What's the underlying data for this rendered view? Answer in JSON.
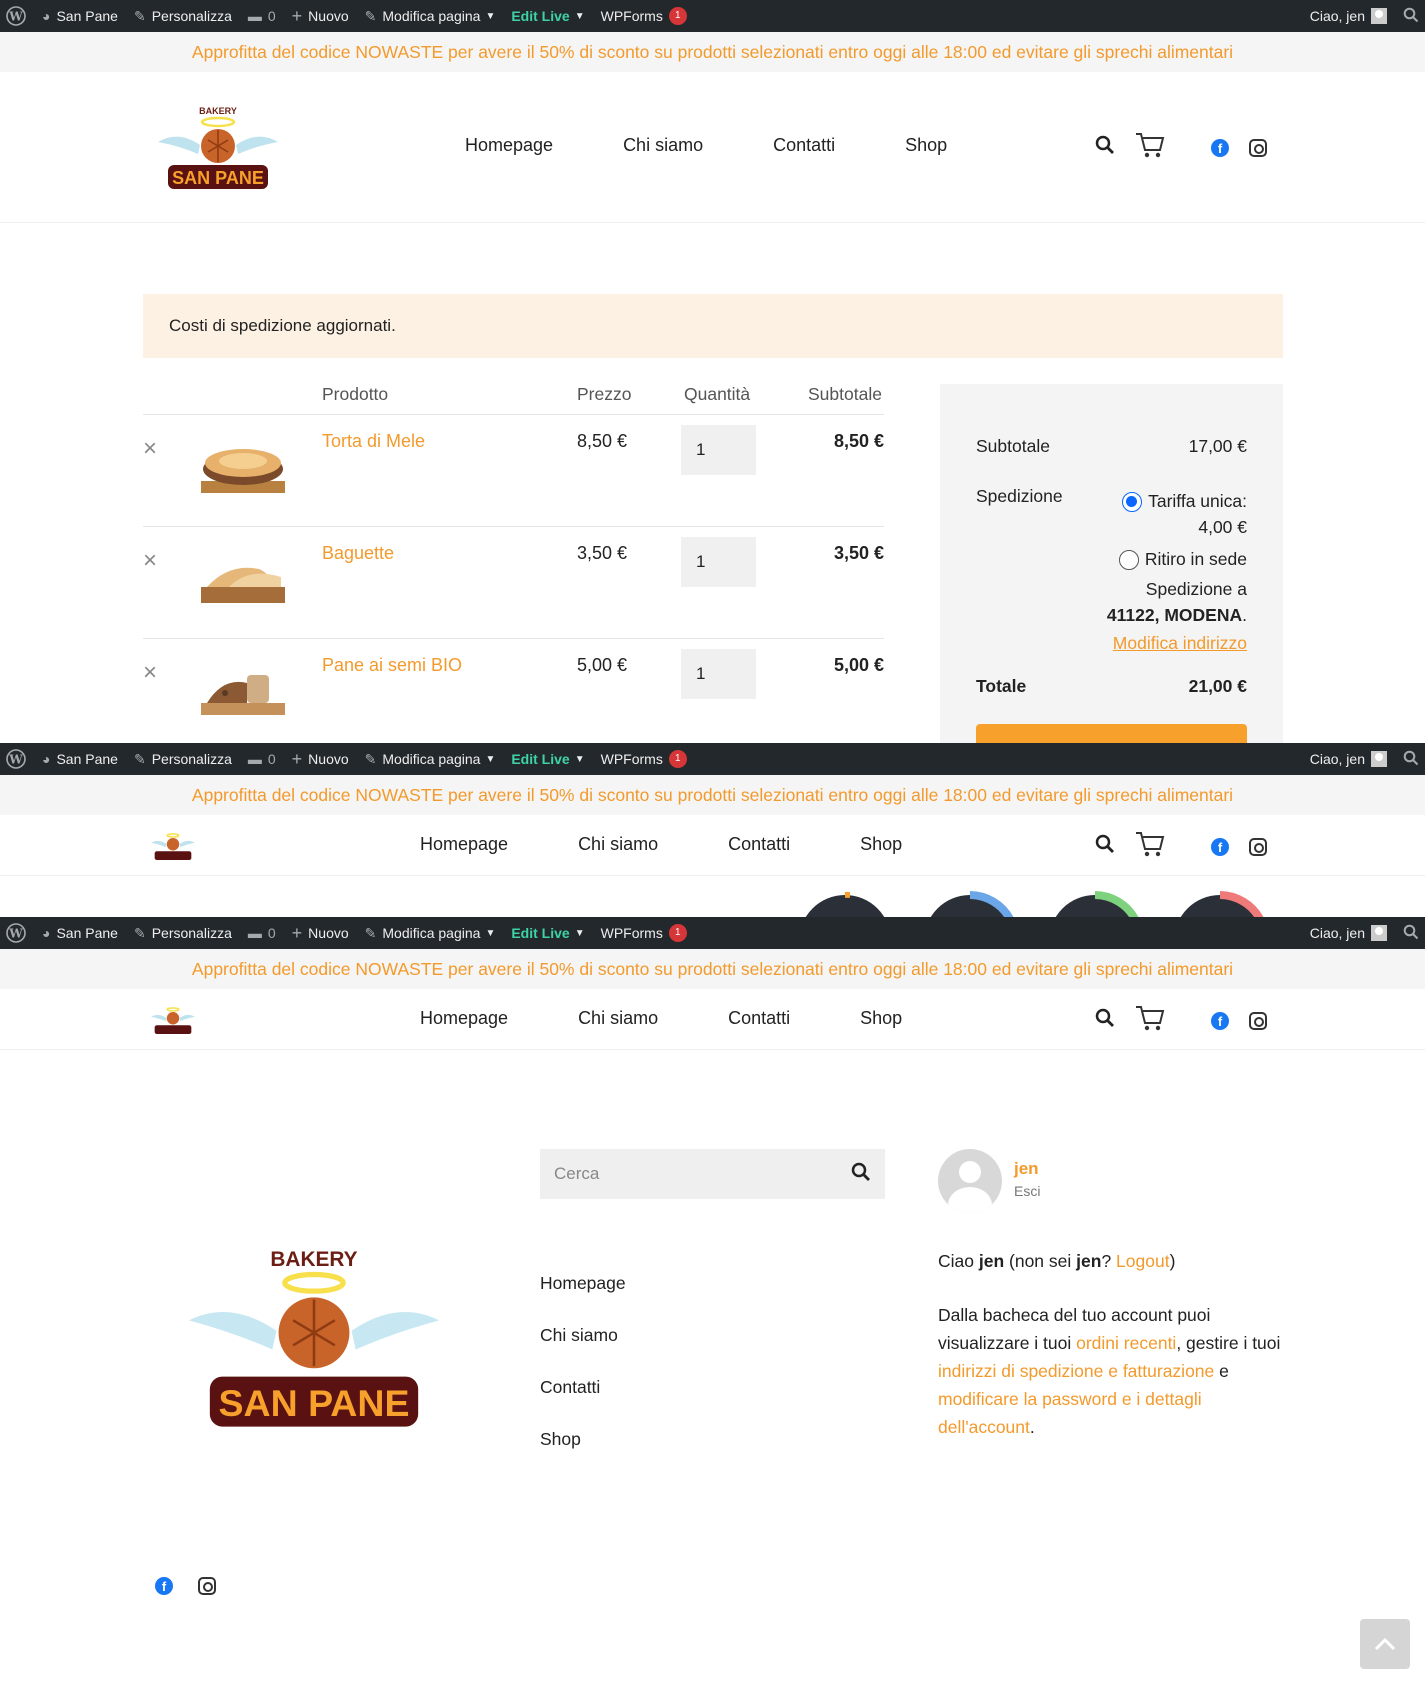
{
  "admin_bar": {
    "site": "San Pane",
    "customize": "Personalizza",
    "comments": "0",
    "new": "Nuovo",
    "edit_page": "Modifica pagina",
    "edit_live": "Edit Live",
    "wpforms": "WPForms",
    "wpforms_badge": "1",
    "greeting": "Ciao, jen"
  },
  "promo": "Approfitta del codice NOWASTE per avere il 50% di sconto su prodotti selezionati entro oggi alle 18:00 ed evitare gli sprechi alimentari",
  "logo": {
    "top": "BAKERY",
    "name": "SAN PANE"
  },
  "menu": [
    "Homepage",
    "Chi siamo",
    "Contatti",
    "Shop"
  ],
  "cart": {
    "notice": "Costi di spedizione aggiornati.",
    "headers": {
      "product": "Prodotto",
      "price": "Prezzo",
      "qty": "Quantità",
      "subtotal": "Subtotale"
    },
    "items": [
      {
        "name": "Torta di Mele",
        "price": "8,50 €",
        "qty": "1",
        "subtotal": "8,50 €"
      },
      {
        "name": "Baguette",
        "price": "3,50 €",
        "qty": "1",
        "subtotal": "3,50 €"
      },
      {
        "name": "Pane ai semi BIO",
        "price": "5,00 €",
        "qty": "1",
        "subtotal": "5,00 €"
      }
    ],
    "remove_icon": "×"
  },
  "totals": {
    "subtotal_label": "Subtotale",
    "subtotal_value": "17,00 €",
    "shipping_label": "Spedizione",
    "option1_a": "Tariffa unica:",
    "option1_b": "4,00 €",
    "option2": "Ritiro in sede",
    "ship_to": "Spedizione a",
    "ship_addr": "41122, MODENA",
    "ship_addr_end": ".",
    "change_address": "Modifica indirizzo",
    "total_label": "Totale",
    "total_value": "21,00 €"
  },
  "footer": {
    "search_placeholder": "Cerca",
    "links": [
      "Homepage",
      "Chi siamo",
      "Contatti",
      "Shop"
    ],
    "user": "jen",
    "logout_short": "Esci",
    "hello_1": "Ciao ",
    "hello_user": "jen",
    "hello_2": " (non sei ",
    "hello_user2": "jen",
    "hello_3": "? ",
    "hello_logout": "Logout",
    "hello_4": ")",
    "dash_1": "Dalla bacheca del tuo account puoi visualizzare i tuoi ",
    "dash_link1": "ordini recenti",
    "dash_2": ", gestire i tuoi ",
    "dash_link2": "indirizzi di spedizione e fatturazione",
    "dash_3": " e ",
    "dash_link3": "modificare la password e i dettagli dell'account",
    "dash_4": "."
  },
  "colors": {
    "accent": "#f39a2c",
    "admin_bg": "#23282d",
    "edit_live": "#3ed3a6"
  }
}
